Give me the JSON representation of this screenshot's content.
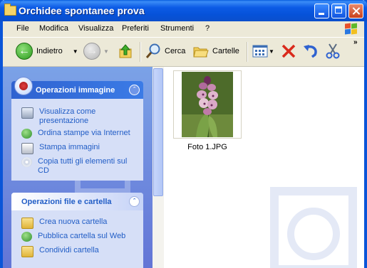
{
  "window": {
    "title": "Orchidee spontanee prova"
  },
  "menu": [
    "File",
    "Modifica",
    "Visualizza",
    "Preferiti",
    "Strumenti",
    "?"
  ],
  "toolbar": {
    "back_label": "Indietro",
    "search_label": "Cerca",
    "folders_label": "Cartelle"
  },
  "panels": {
    "image_tasks": {
      "title": "Operazioni immagine",
      "items": [
        "Visualizza come presentazione",
        "Ordina stampe via Internet",
        "Stampa immagini",
        "Copia tutti gli elementi sul CD"
      ]
    },
    "file_tasks": {
      "title": "Operazioni file e cartella",
      "items": [
        "Crea nuova cartella",
        "Pubblica cartella sul Web",
        "Condividi cartella"
      ]
    }
  },
  "files": [
    {
      "name": "Foto 1.JPG"
    }
  ],
  "colors": {
    "titlebar": "#0a5fe0",
    "task_link": "#215dc6",
    "pane": "#7ba2e7"
  }
}
